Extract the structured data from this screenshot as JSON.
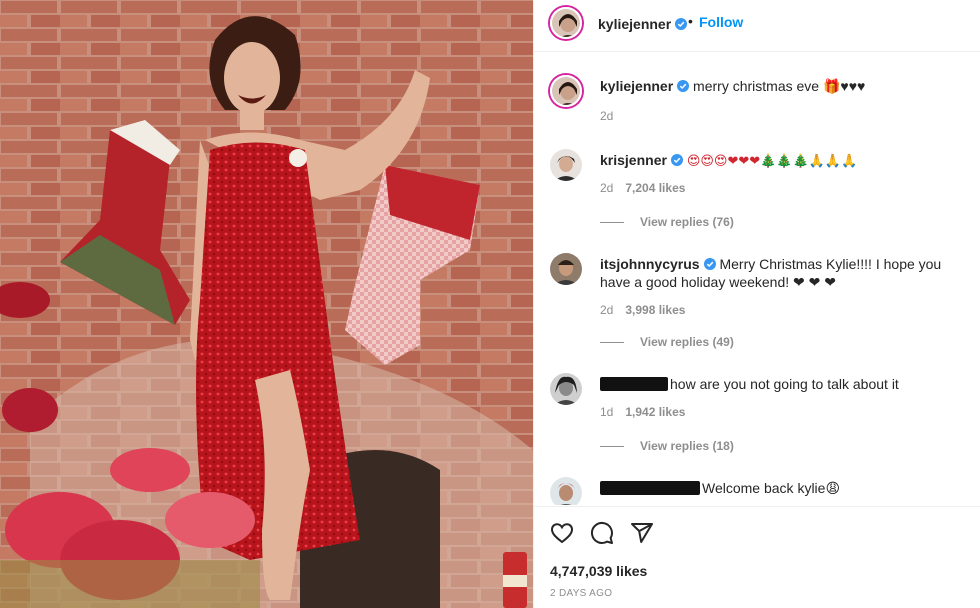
{
  "post": {
    "author": "kyliejenner",
    "follow_label": "Follow",
    "caption": {
      "username": "kyliejenner",
      "text": "merry christmas eve 🎁♥♥♥",
      "time": "2d"
    }
  },
  "comments": [
    {
      "username": "krisjenner",
      "verified": true,
      "text": "😍😍😍❤❤❤🎄🎄🎄🙏🙏🙏",
      "time": "2d",
      "likes": "7,204 likes",
      "replies": "View replies (76)"
    },
    {
      "username": "itsjohnnycyrus",
      "verified": true,
      "text": "Merry Christmas Kylie!!!! I hope you have a good holiday weekend! ❤ ❤ ❤",
      "time": "2d",
      "likes": "3,998 likes",
      "replies": "View replies (49)"
    },
    {
      "username": "",
      "verified": false,
      "text": "how are you not going to talk about it",
      "time": "1d",
      "likes": "1,942 likes",
      "replies": "View replies (18)"
    },
    {
      "username": "",
      "verified": false,
      "text": "Welcome back kylie😩",
      "time": "",
      "likes": "",
      "replies": ""
    }
  ],
  "actions": {
    "likes": "4,747,039 likes",
    "ago": "2 DAYS AGO"
  },
  "colors": {
    "accent": "#0095f6",
    "verified": "#3897f0",
    "muted": "#8e8e8e",
    "text": "#262626"
  }
}
